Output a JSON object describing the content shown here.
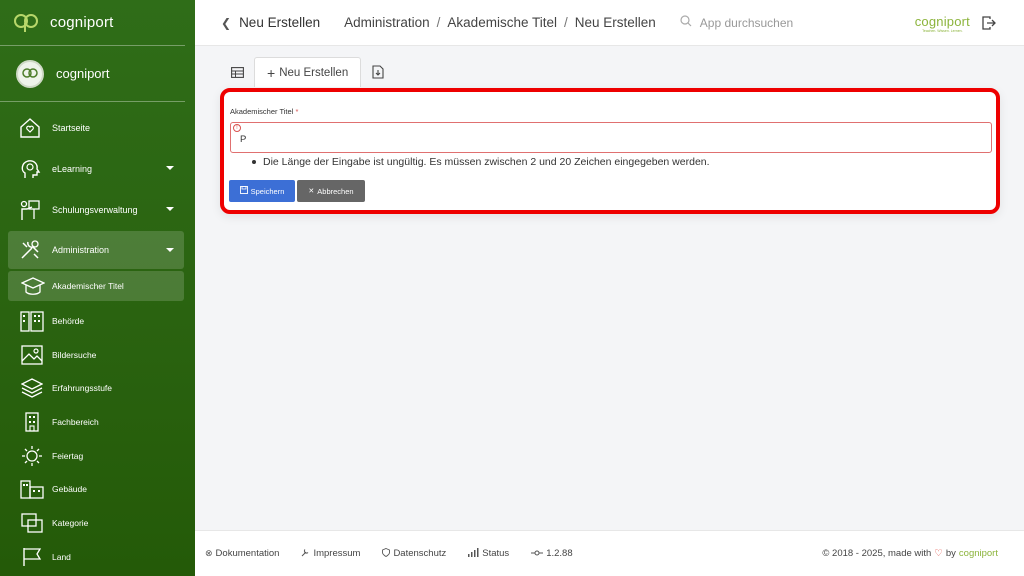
{
  "app": {
    "name": "cogniport"
  },
  "user": {
    "name": "cogniport"
  },
  "sidebar": {
    "items": [
      {
        "label": "Startseite",
        "icon": "home-heart-icon"
      },
      {
        "label": "eLearning",
        "icon": "head-gear-icon"
      },
      {
        "label": "Schulungsverwaltung",
        "icon": "presenter-board-icon"
      },
      {
        "label": "Administration",
        "icon": "tools-icon"
      }
    ],
    "sub_items": [
      {
        "label": "Akademischer Titel",
        "icon": "graduation-cap-icon"
      },
      {
        "label": "Behörde",
        "icon": "building-icon"
      },
      {
        "label": "Bildersuche",
        "icon": "image-icon"
      },
      {
        "label": "Erfahrungsstufe",
        "icon": "layers-icon"
      },
      {
        "label": "Fachbereich",
        "icon": "office-building-icon"
      },
      {
        "label": "Feiertag",
        "icon": "sun-icon"
      },
      {
        "label": "Gebäude",
        "icon": "buildings-icon"
      },
      {
        "label": "Kategorie",
        "icon": "category-icon"
      },
      {
        "label": "Land",
        "icon": "flag-icon"
      }
    ]
  },
  "topbar": {
    "back_label": "Neu Erstellen",
    "breadcrumb": [
      "Administration",
      "Akademische Titel",
      "Neu Erstellen"
    ],
    "search_placeholder": "App durchsuchen",
    "logo_text": "cogniport",
    "logo_tagline": "Teachen. Wissen. Lernen."
  },
  "tabs": {
    "new_label": "Neu Erstellen"
  },
  "form": {
    "label": "Akademischer Titel",
    "required_mark": "*",
    "value": "P",
    "error": "Die Länge der Eingabe ist ungültig. Es müssen zwischen 2 und 20 Zeichen eingegeben werden.",
    "save_label": "Speichern",
    "cancel_label": "Abbrechen"
  },
  "footer": {
    "links": [
      "Dokumentation",
      "Impressum",
      "Datenschutz",
      "Status"
    ],
    "version": "1.2.88",
    "copyright_prefix": "© 2018 - 2025, made with",
    "copyright_by": "by",
    "copyright_brand": "cogniport"
  },
  "colors": {
    "sidebar": "#2a6310",
    "accent": "#8cb43c",
    "primary_button": "#3c6fd6",
    "error_border": "#ee0000"
  }
}
